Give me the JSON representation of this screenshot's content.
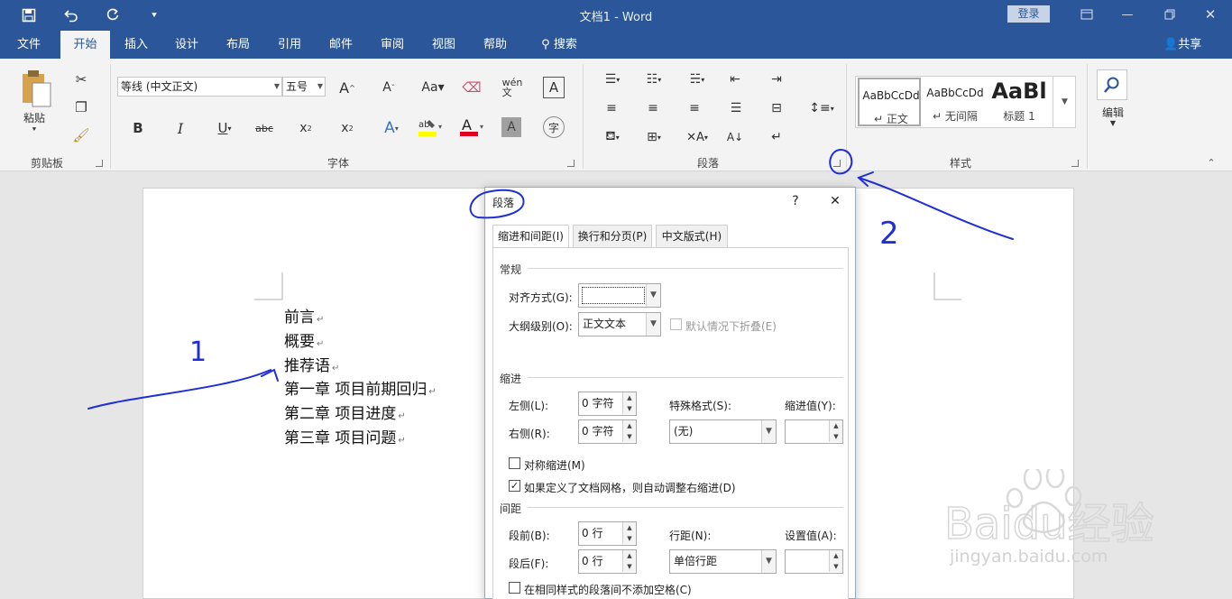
{
  "titlebar": {
    "doc_title": "文档1  -  Word",
    "login": "登录"
  },
  "tabs": [
    "文件",
    "开始",
    "插入",
    "设计",
    "布局",
    "引用",
    "邮件",
    "审阅",
    "视图",
    "帮助",
    "搜索"
  ],
  "active_tab": "开始",
  "share": "共享",
  "ribbon": {
    "clipboard": {
      "paste": "粘贴",
      "group": "剪贴板"
    },
    "font": {
      "name": "等线 (中文正文)",
      "size": "五号",
      "group": "字体"
    },
    "paragraph": {
      "group": "段落"
    },
    "styles": {
      "items": [
        {
          "sample": "AaBbCcDd",
          "name": "正文"
        },
        {
          "sample": "AaBbCcDd",
          "name": "无间隔"
        },
        {
          "sample": "AaBl",
          "name": "标题 1"
        }
      ],
      "group": "样式"
    },
    "editing": {
      "label": "编辑"
    }
  },
  "document": {
    "lines": [
      "前言",
      "概要",
      "推荐语",
      "第一章  项目前期回归",
      "第二章  项目进度",
      "第三章  项目问题"
    ]
  },
  "dialog": {
    "title": "段落",
    "help": "?",
    "tabs": [
      "缩进和间距(I)",
      "换行和分页(P)",
      "中文版式(H)"
    ],
    "general": {
      "section": "常规",
      "alignment_label": "对齐方式(G):",
      "alignment_value": "",
      "outline_label": "大纲级别(O):",
      "outline_value": "正文文本",
      "collapse_label": "默认情况下折叠(E)"
    },
    "indent": {
      "section": "缩进",
      "left_label": "左侧(L):",
      "left_value": "0 字符",
      "right_label": "右侧(R):",
      "right_value": "0 字符",
      "special_label": "特殊格式(S):",
      "special_value": "(无)",
      "by_label": "缩进值(Y):",
      "by_value": "",
      "mirror_label": "对称缩进(M)",
      "auto_adjust_label": "如果定义了文档网格，则自动调整右缩进(D)"
    },
    "spacing": {
      "section": "间距",
      "before_label": "段前(B):",
      "before_value": "0 行",
      "after_label": "段后(F):",
      "after_value": "0 行",
      "line_label": "行距(N):",
      "line_value": "单倍行距",
      "at_label": "设置值(A):",
      "at_value": "",
      "no_space_label": "在相同样式的段落间不添加空格(C)"
    }
  },
  "annotations": {
    "one": "1",
    "two": "2"
  },
  "watermark": {
    "brand": "Baidu经验",
    "url": "jingyan.baidu.com"
  },
  "colors": {
    "word_blue": "#2b579a",
    "ink_blue": "#1f2fd6"
  },
  "icons": [
    "save-icon",
    "undo-icon",
    "redo-icon",
    "customize-icon",
    "restore-icon",
    "minimize-icon",
    "maximize-icon",
    "close-icon",
    "person-icon",
    "search-icon"
  ]
}
